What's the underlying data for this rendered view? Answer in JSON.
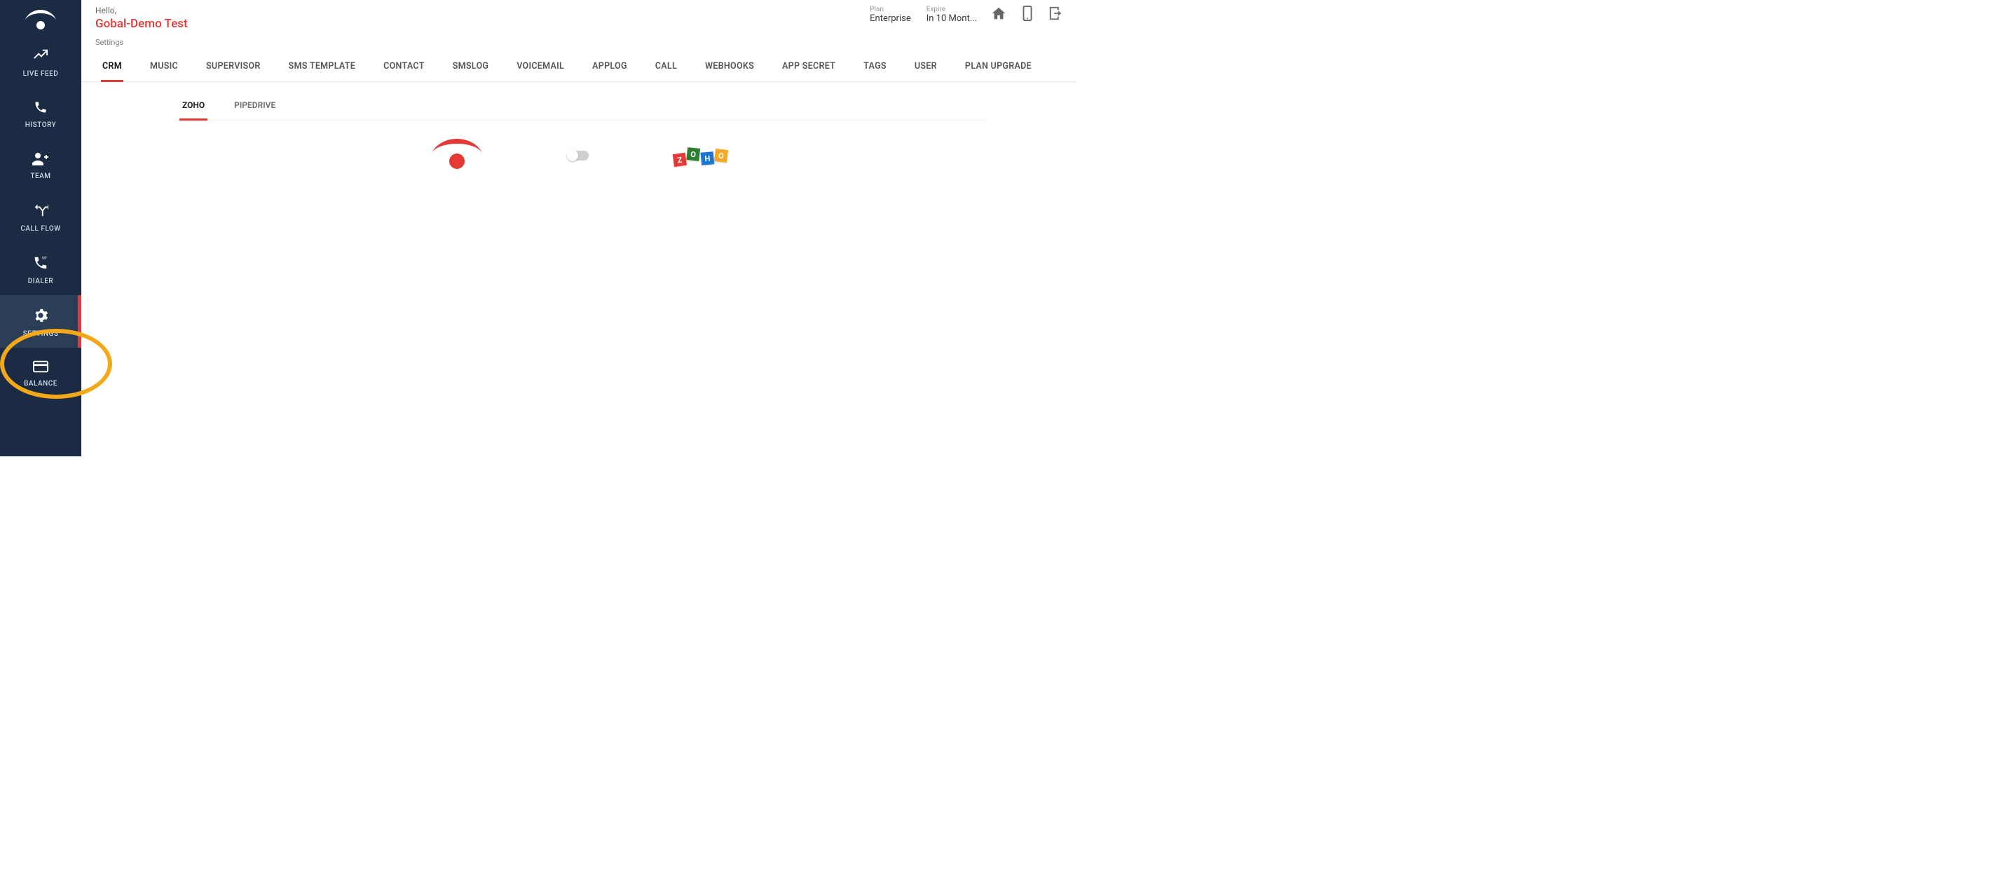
{
  "sidebar": {
    "items": [
      {
        "label": "LIVE FEED"
      },
      {
        "label": "HISTORY"
      },
      {
        "label": "TEAM"
      },
      {
        "label": "CALL FLOW"
      },
      {
        "label": "DIALER"
      },
      {
        "label": "SETTINGS"
      },
      {
        "label": "BALANCE"
      }
    ],
    "activeIndex": 5
  },
  "header": {
    "hello": "Hello,",
    "user": "Gobal-Demo Test",
    "plan_caption": "Plan",
    "plan_value": "Enterprise",
    "expire_caption": "Expire",
    "expire_value": "In 10 Mont..."
  },
  "breadcrumb": "Settings",
  "tabs": [
    "CRM",
    "MUSIC",
    "SUPERVISOR",
    "SMS TEMPLATE",
    "CONTACT",
    "SMSLOG",
    "VOICEMAIL",
    "APPLOG",
    "CALL",
    "WEBHOOKS",
    "APP SECRET",
    "TAGS",
    "USER",
    "PLAN UPGRADE"
  ],
  "tabs_active": 0,
  "subtabs": [
    "ZOHO",
    "PIPEDRIVE"
  ],
  "subtabs_active": 0,
  "integration": {
    "toggle_on": false,
    "zoho_letters": [
      "Z",
      "O",
      "H",
      "O"
    ]
  }
}
